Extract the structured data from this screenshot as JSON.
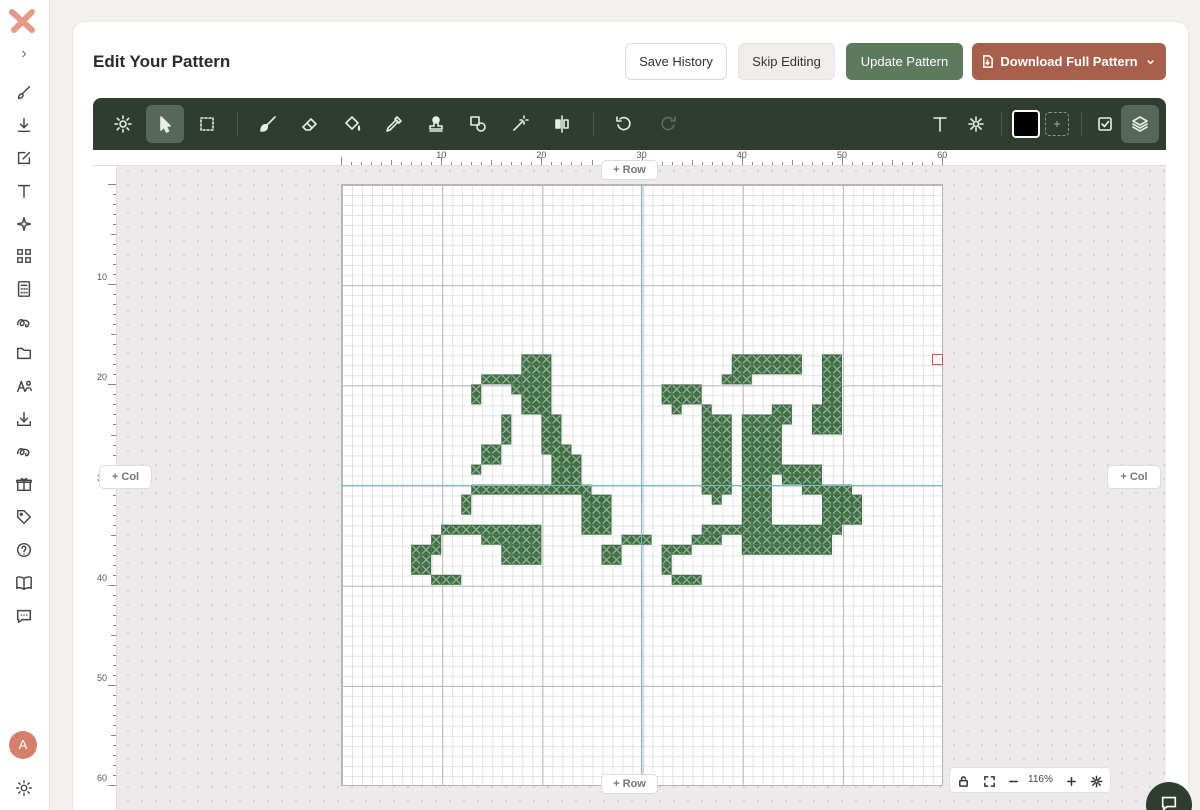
{
  "header": {
    "title": "Edit Your Pattern",
    "save_history": "Save History",
    "skip_editing": "Skip Editing",
    "update_pattern": "Update Pattern",
    "download_full_pattern": "Download Full Pattern"
  },
  "sidebar": {
    "avatar_initial": "A",
    "icons": [
      "brush-icon",
      "download-icon",
      "edit-icon",
      "text-icon",
      "sparkle-icon",
      "qr-icon",
      "calculator-icon",
      "thread-icon",
      "folder-icon",
      "users-icon",
      "download-alt-icon",
      "thread-alt-icon",
      "gift-icon",
      "tag-icon",
      "help-icon",
      "book-icon",
      "chat-icon"
    ]
  },
  "toolbar": {
    "tools": [
      "settings",
      "select",
      "marquee",
      "brush",
      "eraser",
      "fill",
      "eyedropper",
      "stamp",
      "shapes",
      "magic-wand",
      "mirror",
      "undo",
      "redo",
      "text",
      "sparkle"
    ],
    "active_tool": "select",
    "current_color": "#000000"
  },
  "canvas": {
    "add_row": "+ Row",
    "add_col": "+ Col",
    "zoom": "116%",
    "stitch_color": "#3f6a45",
    "ruler_x": [
      "10",
      "20",
      "30",
      "40",
      "50",
      "60"
    ],
    "ruler_y": [
      "10",
      "20",
      "30",
      "40",
      "50",
      "60"
    ]
  }
}
